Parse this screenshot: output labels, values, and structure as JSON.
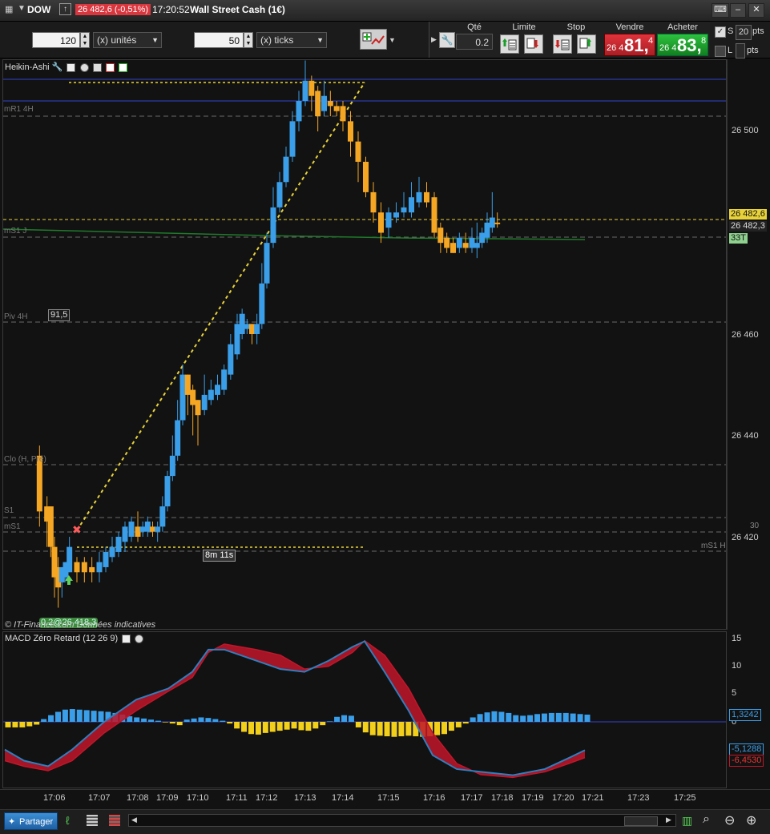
{
  "window": {
    "symbol": "DOW",
    "last_change": "26 482,6 (-0,51%)",
    "time": "17:20:52",
    "instrument": "Wall Street Cash (1€)"
  },
  "toolbar": {
    "qty_value": "120",
    "qty_unit": "(x) unités",
    "ticks_value": "50",
    "ticks_unit": "(x) ticks"
  },
  "trade": {
    "qty_label": "Qté",
    "qty_value": "0.2",
    "limit_label": "Limite",
    "stop_label": "Stop",
    "sell_label": "Vendre",
    "buy_label": "Acheter",
    "sell_prefix": "26 4",
    "sell_big": "81,",
    "sell_small": "4",
    "buy_prefix": "26 4",
    "buy_big": "83,",
    "buy_small": "8",
    "s_label": "S",
    "s_value": "20",
    "pts_label": "pts",
    "l_label": "L",
    "l_pts": "pts"
  },
  "price_panel": {
    "indicator": "Heikin-Ashi",
    "levels": {
      "mr1": "mR1 4H",
      "ms1j": "mS1 J",
      "piv": "Piv 4H",
      "clo": "Clo (H, Pré)",
      "ms1h": "mS1 H",
      "s1": "S1",
      "ms1": "mS1"
    },
    "tags": {
      "box_915": "91,5",
      "timer": "8m 11s",
      "order": "0.2@26 418,3",
      "copyright": "© IT-Finance.com Données indicatives"
    },
    "y_labels": [
      "26 500",
      "26 460",
      "26 440",
      "26 420"
    ],
    "last_price": "26 482,6",
    "bid_price": "26 482,3",
    "count_tag": "33T",
    "hidden_tag": "30"
  },
  "macd_panel": {
    "indicator": "MACD Zéro Retard (12 26 9)",
    "y_labels": [
      "15",
      "10",
      "5",
      "0"
    ],
    "hist_value": "1,3242",
    "macd_value": "-5,1288",
    "signal_value": "-6,4530"
  },
  "x_labels": [
    "17:06",
    "17:07",
    "17:08",
    "17:09",
    "17:10",
    "17:11",
    "17:12",
    "17:13",
    "17:14",
    "17:15",
    "17:16",
    "17:17",
    "17:18",
    "17:19",
    "17:20",
    "17:21",
    "17:23",
    "17:25"
  ],
  "bottom": {
    "share": "Partager"
  },
  "colors": {
    "up": "#3a9ee8",
    "down": "#f5a623",
    "sell": "#d9363e",
    "buy": "#1f9e2e",
    "macd_fill_pos": "#c0162a",
    "level_line": "#6a6a6a"
  },
  "chart_data": [
    {
      "type": "candlestick",
      "title": "Heikin-Ashi",
      "ylim": [
        26408,
        26520
      ],
      "candles": [
        {
          "t": "17:05:40",
          "o": 26436,
          "c": 26425,
          "h": 26438,
          "l": 26422,
          "dir": "down"
        },
        {
          "t": "17:05:50",
          "o": 26426,
          "c": 26423,
          "h": 26428,
          "l": 26418,
          "dir": "down"
        },
        {
          "t": "17:05:55",
          "o": 26426,
          "c": 26418,
          "h": 26426,
          "l": 26416,
          "dir": "down"
        },
        {
          "t": "17:06:00",
          "o": 26418,
          "c": 26412,
          "h": 26420,
          "l": 26408,
          "dir": "down"
        },
        {
          "t": "17:06:05",
          "o": 26414,
          "c": 26410,
          "h": 26416,
          "l": 26406,
          "dir": "down"
        },
        {
          "t": "17:06:10",
          "o": 26411,
          "c": 26414,
          "h": 26414,
          "l": 26408,
          "dir": "up"
        },
        {
          "t": "17:06:15",
          "o": 26412,
          "c": 26415,
          "h": 26415,
          "l": 26411,
          "dir": "up"
        },
        {
          "t": "17:06:20",
          "o": 26413,
          "c": 26418,
          "h": 26420,
          "l": 26413,
          "dir": "up"
        },
        {
          "t": "17:06:30",
          "o": 26415,
          "c": 26413,
          "h": 26416,
          "l": 26411,
          "dir": "down"
        },
        {
          "t": "17:06:40",
          "o": 26415,
          "c": 26413,
          "h": 26416,
          "l": 26411,
          "dir": "down"
        },
        {
          "t": "17:06:50",
          "o": 26414,
          "c": 26413,
          "h": 26416,
          "l": 26411,
          "dir": "down"
        },
        {
          "t": "17:07:00",
          "o": 26413,
          "c": 26415,
          "h": 26417,
          "l": 26411,
          "dir": "up"
        },
        {
          "t": "17:07:10",
          "o": 26414,
          "c": 26417,
          "h": 26418,
          "l": 26413,
          "dir": "up"
        },
        {
          "t": "17:07:20",
          "o": 26416,
          "c": 26418,
          "h": 26420,
          "l": 26415,
          "dir": "up"
        },
        {
          "t": "17:07:30",
          "o": 26417,
          "c": 26420,
          "h": 26421,
          "l": 26416,
          "dir": "up"
        },
        {
          "t": "17:07:40",
          "o": 26419,
          "c": 26422,
          "h": 26423,
          "l": 26417,
          "dir": "up"
        },
        {
          "t": "17:07:50",
          "o": 26420,
          "c": 26423,
          "h": 26424,
          "l": 26419,
          "dir": "up"
        },
        {
          "t": "17:08:00",
          "o": 26422,
          "c": 26420,
          "h": 26425,
          "l": 26419,
          "dir": "down"
        },
        {
          "t": "17:08:10",
          "o": 26421,
          "c": 26422,
          "h": 26423,
          "l": 26420,
          "dir": "up"
        },
        {
          "t": "17:08:20",
          "o": 26421,
          "c": 26423,
          "h": 26424,
          "l": 26420,
          "dir": "up"
        },
        {
          "t": "17:08:30",
          "o": 26422,
          "c": 26421,
          "h": 26423,
          "l": 26420,
          "dir": "down"
        },
        {
          "t": "17:08:40",
          "o": 26421,
          "c": 26422,
          "h": 26423,
          "l": 26419,
          "dir": "up"
        },
        {
          "t": "17:08:50",
          "o": 26422,
          "c": 26426,
          "h": 26428,
          "l": 26421,
          "dir": "up"
        },
        {
          "t": "17:09:00",
          "o": 26426,
          "c": 26432,
          "h": 26433,
          "l": 26425,
          "dir": "up"
        },
        {
          "t": "17:09:10",
          "o": 26432,
          "c": 26436,
          "h": 26440,
          "l": 26431,
          "dir": "up"
        },
        {
          "t": "17:09:20",
          "o": 26436,
          "c": 26443,
          "h": 26447,
          "l": 26435,
          "dir": "up"
        },
        {
          "t": "17:09:30",
          "o": 26443,
          "c": 26452,
          "h": 26454,
          "l": 26442,
          "dir": "up"
        },
        {
          "t": "17:09:40",
          "o": 26452,
          "c": 26448,
          "h": 26452,
          "l": 26444,
          "dir": "down"
        },
        {
          "t": "17:09:50",
          "o": 26449,
          "c": 26446,
          "h": 26450,
          "l": 26440,
          "dir": "down"
        },
        {
          "t": "17:10:00",
          "o": 26447,
          "c": 26444,
          "h": 26447,
          "l": 26438,
          "dir": "down"
        },
        {
          "t": "17:10:10",
          "o": 26445,
          "c": 26448,
          "h": 26452,
          "l": 26444,
          "dir": "up"
        },
        {
          "t": "17:10:20",
          "o": 26447,
          "c": 26449,
          "h": 26451,
          "l": 26446,
          "dir": "up"
        },
        {
          "t": "17:10:30",
          "o": 26448,
          "c": 26450,
          "h": 26452,
          "l": 26447,
          "dir": "up"
        },
        {
          "t": "17:10:40",
          "o": 26449,
          "c": 26453,
          "h": 26454,
          "l": 26448,
          "dir": "up"
        },
        {
          "t": "17:10:50",
          "o": 26452,
          "c": 26458,
          "h": 26460,
          "l": 26451,
          "dir": "up"
        },
        {
          "t": "17:11:00",
          "o": 26456,
          "c": 26462,
          "h": 26464,
          "l": 26455,
          "dir": "up"
        },
        {
          "t": "17:11:10",
          "o": 26460,
          "c": 26464,
          "h": 26465,
          "l": 26459,
          "dir": "up"
        },
        {
          "t": "17:11:20",
          "o": 26461,
          "c": 26462,
          "h": 26463,
          "l": 26460,
          "dir": "up"
        },
        {
          "t": "17:11:30",
          "o": 26462,
          "c": 26460,
          "h": 26462,
          "l": 26458,
          "dir": "down"
        },
        {
          "t": "17:11:40",
          "o": 26460,
          "c": 26462,
          "h": 26464,
          "l": 26458,
          "dir": "up"
        },
        {
          "t": "17:11:50",
          "o": 26462,
          "c": 26470,
          "h": 26474,
          "l": 26461,
          "dir": "up"
        },
        {
          "t": "17:12:00",
          "o": 26470,
          "c": 26478,
          "h": 26480,
          "l": 26469,
          "dir": "up"
        },
        {
          "t": "17:12:10",
          "o": 26478,
          "c": 26485,
          "h": 26489,
          "l": 26477,
          "dir": "up"
        },
        {
          "t": "17:12:20",
          "o": 26485,
          "c": 26490,
          "h": 26492,
          "l": 26484,
          "dir": "up"
        },
        {
          "t": "17:12:30",
          "o": 26490,
          "c": 26495,
          "h": 26497,
          "l": 26489,
          "dir": "up"
        },
        {
          "t": "17:12:40",
          "o": 26495,
          "c": 26502,
          "h": 26504,
          "l": 26494,
          "dir": "up"
        },
        {
          "t": "17:12:50",
          "o": 26502,
          "c": 26506,
          "h": 26508,
          "l": 26500,
          "dir": "up"
        },
        {
          "t": "17:13:00",
          "o": 26506,
          "c": 26510,
          "h": 26514,
          "l": 26505,
          "dir": "up"
        },
        {
          "t": "17:13:10",
          "o": 26510,
          "c": 26507,
          "h": 26511,
          "l": 26504,
          "dir": "down"
        },
        {
          "t": "17:13:20",
          "o": 26508,
          "c": 26503,
          "h": 26509,
          "l": 26500,
          "dir": "down"
        },
        {
          "t": "17:13:30",
          "o": 26504,
          "c": 26507,
          "h": 26510,
          "l": 26503,
          "dir": "up"
        },
        {
          "t": "17:13:40",
          "o": 26506,
          "c": 26505,
          "h": 26508,
          "l": 26503,
          "dir": "down"
        },
        {
          "t": "17:13:50",
          "o": 26505,
          "c": 26504,
          "h": 26506,
          "l": 26503,
          "dir": "down"
        },
        {
          "t": "17:14:00",
          "o": 26505,
          "c": 26502,
          "h": 26506,
          "l": 26500,
          "dir": "down"
        },
        {
          "t": "17:14:10",
          "o": 26502,
          "c": 26498,
          "h": 26504,
          "l": 26495,
          "dir": "down"
        },
        {
          "t": "17:14:20",
          "o": 26498,
          "c": 26494,
          "h": 26500,
          "l": 26490,
          "dir": "down"
        },
        {
          "t": "17:14:30",
          "o": 26494,
          "c": 26488,
          "h": 26495,
          "l": 26487,
          "dir": "down"
        },
        {
          "t": "17:14:40",
          "o": 26488,
          "c": 26484,
          "h": 26490,
          "l": 26482,
          "dir": "down"
        },
        {
          "t": "17:14:50",
          "o": 26484,
          "c": 26480,
          "h": 26486,
          "l": 26478,
          "dir": "down"
        },
        {
          "t": "17:15:00",
          "o": 26481,
          "c": 26484,
          "h": 26485,
          "l": 26479,
          "dir": "up"
        },
        {
          "t": "17:15:10",
          "o": 26483,
          "c": 26484,
          "h": 26486,
          "l": 26482,
          "dir": "up"
        },
        {
          "t": "17:15:20",
          "o": 26484,
          "c": 26485,
          "h": 26488,
          "l": 26483,
          "dir": "up"
        },
        {
          "t": "17:15:30",
          "o": 26484,
          "c": 26487,
          "h": 26490,
          "l": 26483,
          "dir": "up"
        },
        {
          "t": "17:15:40",
          "o": 26486,
          "c": 26488,
          "h": 26491,
          "l": 26485,
          "dir": "up"
        },
        {
          "t": "17:15:50",
          "o": 26488,
          "c": 26486,
          "h": 26490,
          "l": 26485,
          "dir": "down"
        },
        {
          "t": "17:16:00",
          "o": 26487,
          "c": 26480,
          "h": 26488,
          "l": 26479,
          "dir": "down"
        },
        {
          "t": "17:16:10",
          "o": 26481,
          "c": 26478,
          "h": 26482,
          "l": 26476,
          "dir": "down"
        },
        {
          "t": "17:16:20",
          "o": 26479,
          "c": 26477,
          "h": 26480,
          "l": 26476,
          "dir": "down"
        },
        {
          "t": "17:16:30",
          "o": 26478,
          "c": 26476,
          "h": 26479,
          "l": 26476,
          "dir": "down"
        },
        {
          "t": "17:16:40",
          "o": 26477,
          "c": 26479,
          "h": 26480,
          "l": 26476,
          "dir": "up"
        },
        {
          "t": "17:16:50",
          "o": 26478,
          "c": 26477,
          "h": 26480,
          "l": 26476,
          "dir": "down"
        },
        {
          "t": "17:17:00",
          "o": 26477,
          "c": 26479,
          "h": 26481,
          "l": 26476,
          "dir": "up"
        },
        {
          "t": "17:17:10",
          "o": 26477,
          "c": 26478,
          "h": 26482,
          "l": 26475,
          "dir": "up"
        },
        {
          "t": "17:17:20",
          "o": 26478,
          "c": 26480,
          "h": 26481,
          "l": 26477,
          "dir": "up"
        },
        {
          "t": "17:17:30",
          "o": 26479,
          "c": 26482,
          "h": 26484,
          "l": 26478,
          "dir": "up"
        },
        {
          "t": "17:17:40",
          "o": 26481,
          "c": 26483,
          "h": 26488,
          "l": 26480,
          "dir": "up"
        },
        {
          "t": "17:17:50",
          "o": 26482,
          "c": 26482,
          "h": 26484,
          "l": 26481,
          "dir": "down"
        }
      ]
    },
    {
      "type": "histogram_line",
      "title": "MACD Zéro Retard (12 26 9)",
      "ylim": [
        -10,
        16
      ],
      "hist_latest": 1.3242,
      "macd_latest": -5.1288,
      "signal_latest": -6.453
    }
  ]
}
